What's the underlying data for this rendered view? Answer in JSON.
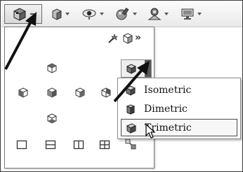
{
  "toolbar": {
    "buttons": [
      {
        "icon": "view-orientation-icon",
        "state": "pressed"
      },
      {
        "icon": "display-style-icon"
      },
      {
        "icon": "hide-show-items-icon"
      },
      {
        "icon": "edit-appearance-icon"
      },
      {
        "icon": "apply-scene-icon"
      },
      {
        "icon": "view-settings-icon"
      }
    ]
  },
  "panel": {
    "top_icons": [
      "new-view-icon",
      "update-standard-views-icon"
    ],
    "more_label": "»",
    "grid_icons": [
      "top-view-icon",
      "left-view-icon",
      "front-view-icon",
      "right-view-icon",
      "back-view-icon",
      "bottom-view-icon",
      "single-view-icon",
      "two-view-horizontal-icon",
      "two-view-vertical-icon",
      "four-view-icon",
      "link-views-icon"
    ]
  },
  "flyout": {
    "items": [
      {
        "label": "Isometric",
        "icon": "isometric-cube-icon",
        "selected": false
      },
      {
        "label": "Dimetric",
        "icon": "dimetric-cube-icon",
        "selected": false
      },
      {
        "label": "Trimetric",
        "icon": "trimetric-cube-icon",
        "selected": true
      }
    ]
  },
  "colors": {
    "pointer_arrow": "#111111",
    "selection_border": "#4a4a4a",
    "toolbar_bg": "#e9e9e9"
  }
}
